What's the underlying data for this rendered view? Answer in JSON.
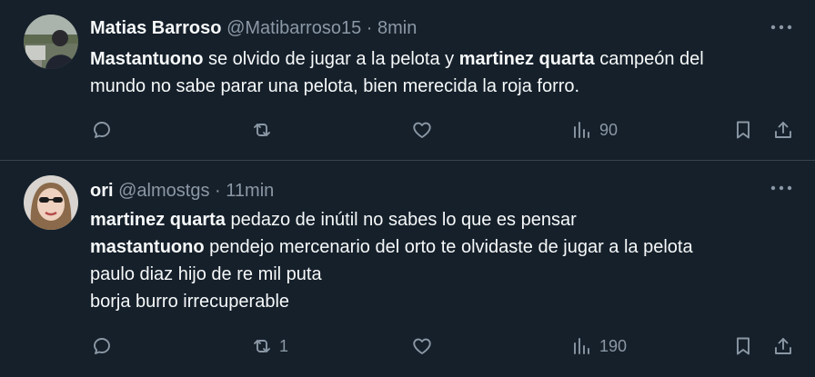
{
  "tweets": [
    {
      "name": "Matias Barroso",
      "handle": "@Matibarroso15",
      "sep": "·",
      "time": "8min",
      "lines": [
        [
          {
            "b": "Mastantuono"
          },
          {
            "t": " se olvido de jugar a la pelota y "
          },
          {
            "b": "martinez quarta"
          },
          {
            "t": " campeón del"
          }
        ],
        [
          {
            "t": "mundo no sabe parar una pelota, bien merecida la roja forro."
          }
        ]
      ],
      "retweets": "",
      "views": "90",
      "icons": {
        "reply": "reply-icon",
        "retweet": "retweet-icon",
        "like": "heart-icon",
        "views": "views-chart-icon",
        "bookmark": "bookmark-icon",
        "share": "share-icon",
        "more": "more-dots-icon"
      }
    },
    {
      "name": "ori",
      "handle": "@almostgs",
      "sep": "·",
      "time": "11min",
      "lines": [
        [
          {
            "b": "martinez quarta"
          },
          {
            "t": " pedazo de inútil no sabes lo que es pensar"
          }
        ],
        [
          {
            "b": "mastantuono"
          },
          {
            "t": " pendejo mercenario del orto te olvidaste de jugar a la pelota"
          }
        ],
        [
          {
            "t": "paulo diaz hijo de re mil puta"
          }
        ],
        [
          {
            "t": "borja burro irrecuperable"
          }
        ]
      ],
      "retweets": "1",
      "views": "190",
      "icons": {
        "reply": "reply-icon",
        "retweet": "retweet-icon",
        "like": "heart-icon",
        "views": "views-chart-icon",
        "bookmark": "bookmark-icon",
        "share": "share-icon",
        "more": "more-dots-icon"
      }
    }
  ],
  "colors": {
    "background": "#15202b",
    "text": "#f7f9f9",
    "muted": "#8b98a5",
    "divider": "#38444d"
  }
}
